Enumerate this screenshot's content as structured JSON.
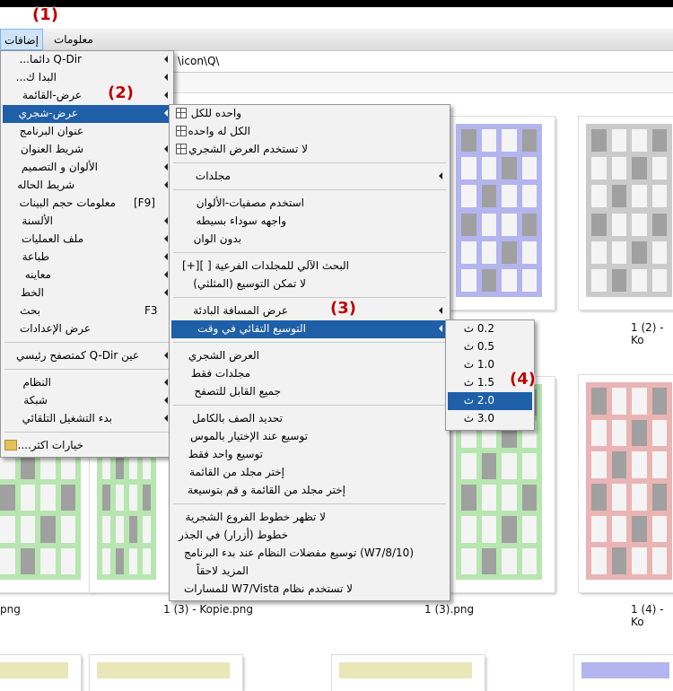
{
  "menubar": {
    "items": [
      "معلومات",
      "إضافات"
    ]
  },
  "address": {
    "path": "\\icon\\Q\\"
  },
  "thumbnails": {
    "labels": [
      "1 (3) - Kopie.png",
      "1 (3).png",
      "1 (4) - Ko",
      "1 (2) - Ko",
      "png"
    ]
  },
  "menu1": {
    "items": [
      {
        "label": "Q-Dir دائما..."
      },
      {
        "label": "البدا ك..."
      },
      {
        "label": "عرض-القائمة"
      },
      {
        "label": "عرض-شجري"
      },
      {
        "label": "عنوان البرنامج"
      },
      {
        "label": "شريط العنوان"
      },
      {
        "label": "الألوان و التصميم"
      },
      {
        "label": "شريط الحاله"
      },
      {
        "label": "معلومات حجم البينات",
        "shortcut": "[F9]"
      },
      {
        "label": "الألسنة"
      },
      {
        "label": "ملف العمليات"
      },
      {
        "label": "طباعة"
      },
      {
        "label": "معاينه"
      },
      {
        "label": "الخط"
      },
      {
        "label": "بحث",
        "shortcut": "F3"
      },
      {
        "label": "عرض الإعدادات"
      },
      {
        "label": "عين Q-Dir كمتصفح رئيسي"
      },
      {
        "label": "النظام"
      },
      {
        "label": "شبكة"
      },
      {
        "label": "بدء التشغيل التلقائي"
      },
      {
        "label": "خيارات اكثر...."
      }
    ]
  },
  "menu2": {
    "items": [
      {
        "label": "واحده للكل"
      },
      {
        "label": "الكل له واحده"
      },
      {
        "label": "لا تستخدم العرض الشجري"
      },
      {
        "label": "مجلدات"
      },
      {
        "label": "استخدم مصفيات-الألوان"
      },
      {
        "label": "واجهه سوداء بسيطه"
      },
      {
        "label": "بدون الوان"
      },
      {
        "label": "البحث الآلي للمجلدات الفرعية [ ][+]"
      },
      {
        "label": "لا تمكن التوسيع (المثلثي)"
      },
      {
        "label": "عرض المسافة البادئة"
      },
      {
        "label": "التوسيع التقائي في وقت"
      },
      {
        "label": "العرض الشجري"
      },
      {
        "label": "مجلدات فقط"
      },
      {
        "label": "جميع القابل للتصفح"
      },
      {
        "label": "تحديد الصف بالكامل"
      },
      {
        "label": "توسيع عند الإختيار بالموس"
      },
      {
        "label": "توسيع واحد فقط"
      },
      {
        "label": "إختر مجلد من القائمة"
      },
      {
        "label": "إختر مجلد من القائمة و قم بتوسيعة"
      },
      {
        "label": "لا تظهر خطوط الفروع الشجرية"
      },
      {
        "label": "خطوط (أزرار) في الجذر"
      },
      {
        "label": "(W7/8/10) توسيع مفضلات النظام عند بدء البرنامج"
      },
      {
        "label": "المزيد لاحقاً"
      },
      {
        "label": "لا تستخدم نظام W7/Vista للمسارات"
      }
    ]
  },
  "menu3": {
    "items": [
      {
        "label": "0.2 ث"
      },
      {
        "label": "0.5 ث"
      },
      {
        "label": "1.0 ث"
      },
      {
        "label": "1.5 ث"
      },
      {
        "label": "2.0 ث"
      },
      {
        "label": "3.0 ث"
      }
    ]
  },
  "callouts": [
    "(1)",
    "(2)",
    "(3)",
    "(4)"
  ],
  "colors": {
    "highlight": "#1f5fa8",
    "callout": "#c00000",
    "thumb_blue": "#b4b4ef",
    "thumb_gray": "#cbcbcb",
    "thumb_green": "#b7e6b0",
    "thumb_red": "#eab4b4",
    "thumb_yellow": "#e9e6b8"
  }
}
